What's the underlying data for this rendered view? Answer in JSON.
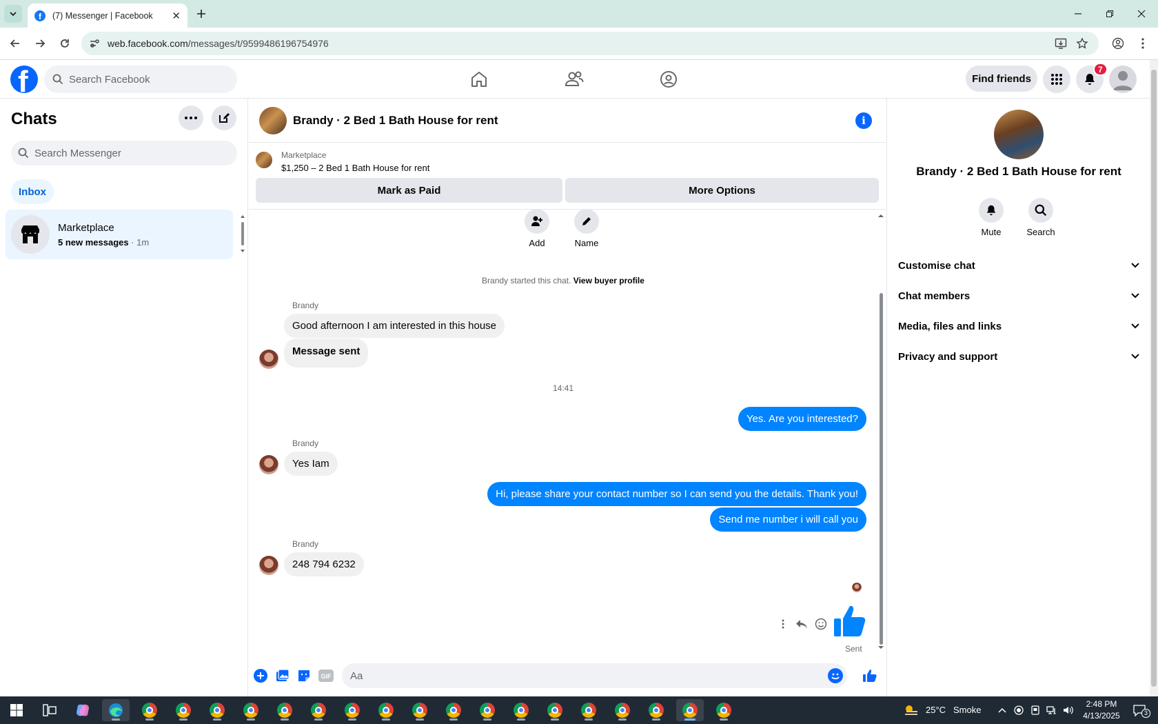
{
  "browser": {
    "tab_title": "(7) Messenger | Facebook",
    "url_host": "web.facebook.com",
    "url_path": "/messages/t/9599486196754976"
  },
  "fb": {
    "search_placeholder": "Search Facebook",
    "find_friends": "Find friends",
    "notification_count": "7",
    "brand_color": "#0866ff"
  },
  "sidebar": {
    "title": "Chats",
    "search_placeholder": "Search Messenger",
    "filter": "Inbox",
    "chat": {
      "name": "Marketplace",
      "preview": "5 new messages",
      "time": " · 1m"
    }
  },
  "conversation": {
    "title": "Brandy · 2 Bed 1 Bath House for rent",
    "listing_label": "Marketplace",
    "listing_price": "$1,250 – 2 Bed 1 Bath House for rent",
    "mark_paid": "Mark as Paid",
    "more_options": "More Options",
    "actions": [
      {
        "label": "Add",
        "icon": "add-person-icon"
      },
      {
        "label": "Name",
        "icon": "pencil-icon"
      }
    ],
    "started_prefix": "Brandy started this chat. ",
    "started_link": "View buyer profile",
    "timestamp": "14:41",
    "messages": [
      {
        "from": "Brandy",
        "sender_label": "Brandy",
        "text": "Good afternoon I am interested in this house"
      },
      {
        "from": "Brandy",
        "text": "Message sent"
      },
      {
        "from": "me",
        "text": "Yes. Are you interested?"
      },
      {
        "from": "Brandy",
        "sender_label": "Brandy",
        "text": "Yes Iam"
      },
      {
        "from": "me",
        "text": "Hi, please share your contact number so I can send you the details. Thank you!"
      },
      {
        "from": "me",
        "text": "Send me number i will call you"
      },
      {
        "from": "Brandy",
        "sender_label": "Brandy",
        "text": "248 794 6232"
      }
    ],
    "sent_label": "Sent",
    "composer_placeholder": "Aa"
  },
  "info_panel": {
    "name": "Brandy · 2 Bed 1 Bath House for rent",
    "actions": [
      {
        "label": "Mute",
        "icon": "bell-icon"
      },
      {
        "label": "Search",
        "icon": "search-icon"
      }
    ],
    "sections": [
      "Customise chat",
      "Chat members",
      "Media, files and links",
      "Privacy and support"
    ]
  },
  "taskbar": {
    "weather": "25°C",
    "weather_desc": "Smoke",
    "time": "2:48 PM",
    "date": "4/13/2025",
    "notif_count": "3"
  }
}
